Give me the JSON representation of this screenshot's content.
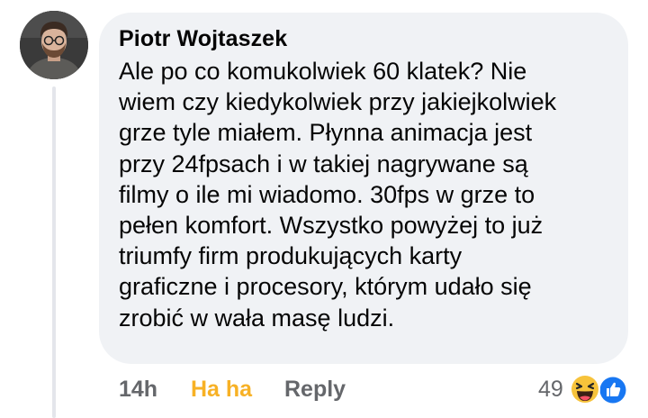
{
  "comment": {
    "author": "Piotr Wojtaszek",
    "text": "Ale po co komukolwiek 60 klatek? Nie\nwiem czy kiedykolwiek przy jakiejkolwiek\ngrze tyle miałem. Płynna animacja jest\nprzy 24fpsach i w takiej nagrywane są\nfilmy o ile mi wiadomo. 30fps w grze to\npełen komfort. Wszystko powyżej to już\ntriumfy firm produkujących karty\ngraficzne i procesory, którym udało się\nzrobić w wała masę ludzi."
  },
  "actions": {
    "time": "14h",
    "reaction_label": "Ha ha",
    "reply_label": "Reply"
  },
  "reactions": {
    "count": "49",
    "icons": [
      "haha-icon",
      "like-icon"
    ]
  },
  "colors": {
    "bubble": "#f0f2f5",
    "haha_accent": "#f7b125",
    "secondary_text": "#65676b",
    "like_blue": "#1877f2"
  }
}
